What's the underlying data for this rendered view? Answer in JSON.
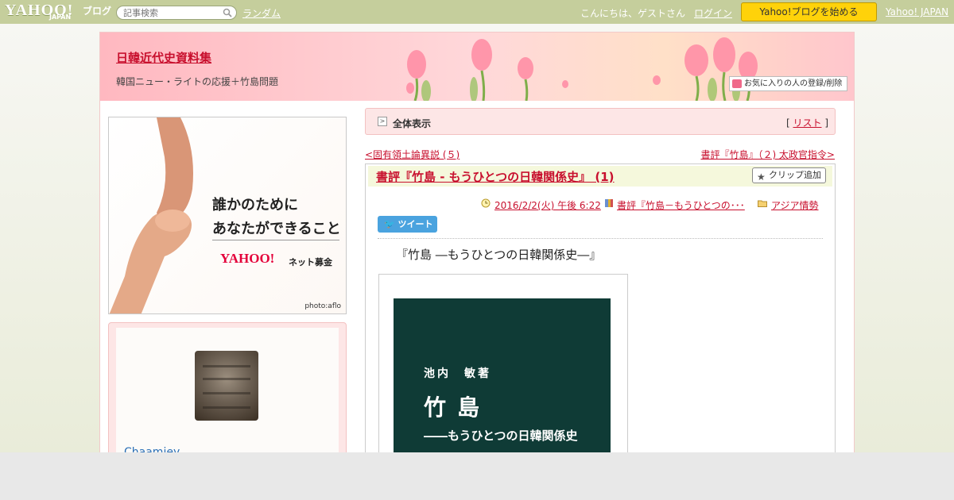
{
  "topbar": {
    "logo_main": "YAHOO!",
    "logo_sub": "JAPAN",
    "logo_blog": "ブログ",
    "search_placeholder": "記事検索",
    "random_label": "ランダム",
    "greeting": "こんにちは、ゲストさん",
    "login_label": "ログイン",
    "start_button": "Yahoo!ブログを始める",
    "yahoo_japan_link": "Yahoo! JAPAN"
  },
  "header": {
    "blog_title": "日韓近代史資料集",
    "blog_subtitle": "韓国ニュー・ライトの応援＋竹島問題",
    "favorite_button": "お気に入りの人の登録/削除"
  },
  "ad": {
    "line1": "誰かのために",
    "line2": "あなたができること",
    "logo": "YAHOO!",
    "logo_sub": "ネット募金",
    "credit": "photo:aflo"
  },
  "profile": {
    "username": "Chaamiey"
  },
  "nav": {
    "all_view_label": "全体表示",
    "list_label": "リスト",
    "prev_link": "<固有領土論異説 (５)",
    "next_link": "書評『竹島』（２) 太政官指令>"
  },
  "article": {
    "title": "書評『竹島 - もうひとつの日韓関係史』 (1)",
    "clip_button": "クリップ追加",
    "date": "2016/2/2(火) 午後 6:22",
    "book_link": "書評『竹島－もうひとつの･･･",
    "category": "アジア情勢",
    "tweet_label": "ツイート",
    "body_title": "『竹島 ―もうひとつの日韓関係史―』",
    "cover_author": "池内　敏著",
    "cover_title": "竹島",
    "cover_subtitle": "――もうひとつの日韓関係史"
  },
  "colors": {
    "accent_red": "#c8102e",
    "topbar_green": "#c5ce9c",
    "start_button_yellow": "#ffd20a",
    "tweet_blue": "#4aa3df",
    "cover_green": "#0f3b36"
  }
}
